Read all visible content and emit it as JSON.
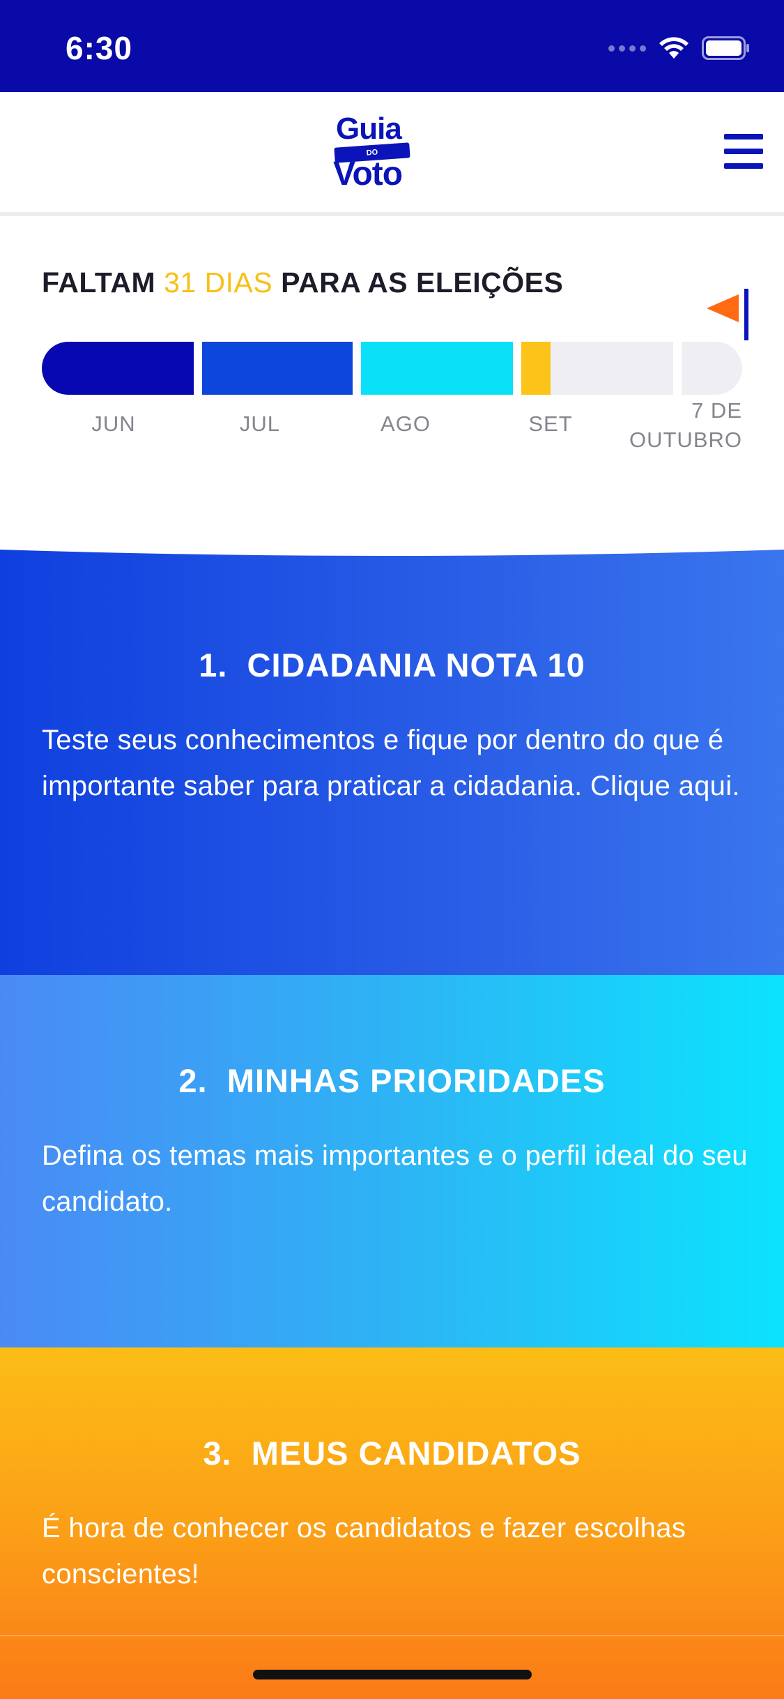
{
  "status_bar": {
    "time": "6:30"
  },
  "header": {
    "logo": {
      "line1": "Guia",
      "band": "DO",
      "line2": "Voto"
    }
  },
  "countdown": {
    "title_prefix": "FALTAM",
    "days_highlight": "31 DIAS",
    "title_suffix": "PARA AS ELEIÇÕES",
    "months": [
      "JUN",
      "JUL",
      "AGO",
      "SET"
    ],
    "end_label": "7 DE OUTUBRO",
    "colors": {
      "jun": "#0708b1",
      "jul": "#0d46dc",
      "ago": "#0ae1f8",
      "set": "#fcc419",
      "empty": "#efeff3",
      "highlight": "#f8c017",
      "flag": "#ff6a13"
    }
  },
  "cards": [
    {
      "number": "1.",
      "title": "CIDADANIA NOTA 10",
      "description": "Teste seus conhecimentos e fique por dentro do que é importante saber para praticar a cidadania. Clique aqui."
    },
    {
      "number": "2.",
      "title": "MINHAS PRIORIDADES",
      "description": "Defina os temas mais importantes e o perfil ideal do seu candidato."
    },
    {
      "number": "3.",
      "title": "MEUS CANDIDATOS",
      "description": "É hora de conhecer os candidatos e fazer escolhas conscientes!"
    }
  ],
  "icons": {
    "menu": "hamburger-menu-icon",
    "flag": "flag-icon",
    "wifi": "wifi-icon",
    "battery": "battery-icon"
  }
}
